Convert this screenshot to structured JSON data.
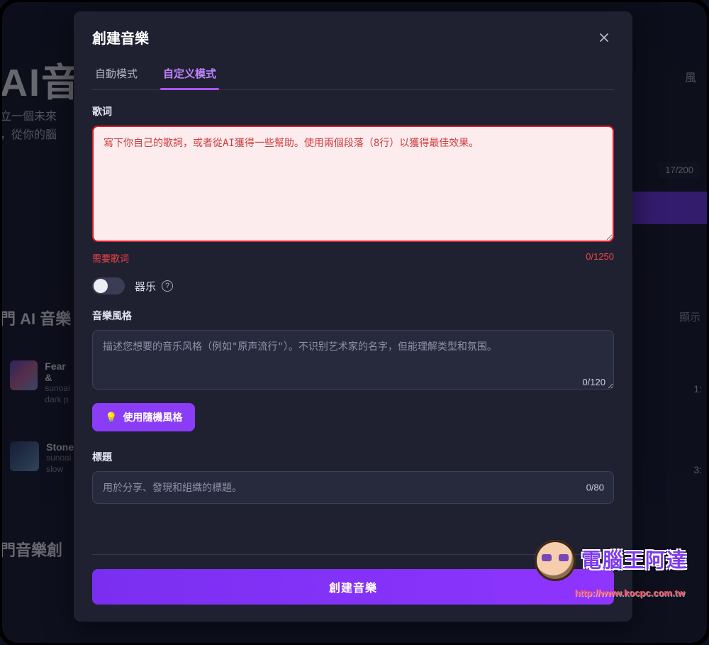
{
  "background": {
    "headline": "AI音樂",
    "sub1": "立一個未來",
    "sub2": "，從你的腦",
    "counter": "17/200",
    "section1_title": "門 AI 音樂",
    "section2_title": "門音樂創",
    "show_label": "顯示",
    "card1": {
      "title": "Fear &",
      "artist": "sunoai",
      "tags": "dark p",
      "time": "1:"
    },
    "card2": {
      "title": "Stone",
      "artist": "sunoai",
      "tags": "slow",
      "time": "3:"
    },
    "right_char": "風"
  },
  "modal": {
    "title": "創建音樂",
    "tabs": {
      "auto": "自動模式",
      "custom": "自定义模式"
    },
    "lyrics": {
      "label": "歌词",
      "placeholder": "寫下你自己的歌詞，或者從AI獲得一些幫助。使用兩個段落（8行）以獲得最佳效果。",
      "error": "需要歌词",
      "count": "0/1250"
    },
    "instrumental": {
      "label": "器乐"
    },
    "style": {
      "label": "音樂風格",
      "placeholder": "描述您想要的音乐风格（例如\"原声流行\"）。不识别艺术家的名字，但能理解类型和氛围。",
      "count": "0/120",
      "random_button": "使用隨機風格"
    },
    "titleField": {
      "label": "標題",
      "placeholder": "用於分享、發現和組織的標題。",
      "count": "0/80"
    },
    "submit": "創建音樂"
  },
  "watermark": {
    "brand": "電腦王阿達",
    "url": "http://www.kocpc.com.tw"
  }
}
